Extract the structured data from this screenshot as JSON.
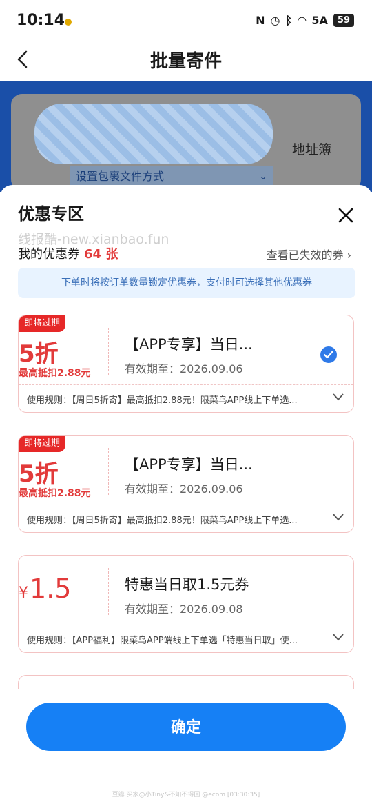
{
  "status_bar": {
    "time": "10:14",
    "icons": [
      "nfc-icon",
      "alarm-icon",
      "bluetooth-icon",
      "wifi-icon",
      "signal-5g-icon"
    ],
    "network": "5A",
    "battery": "59"
  },
  "nav": {
    "title": "批量寄件"
  },
  "background": {
    "address_book": "地址簿",
    "package_method": "设置包裹文件方式"
  },
  "sheet": {
    "title": "优惠专区",
    "watermark": "线报酷-new.xianbao.fun",
    "my_coupons_label": "我的优惠券",
    "my_coupons_count": "64 张",
    "expired_link": "查看已失效的券",
    "notice": "下单时将按订单数量锁定优惠券，支付时可选择其他优惠券"
  },
  "coupons": [
    {
      "badge": "即将过期",
      "discount": "5折",
      "max_deduct": "最高抵扣2.88元",
      "title": "【APP专享】当日...",
      "valid": "有效期至：2026.09.06",
      "rule": "使用规则：【周日5折寄】最高抵扣2.88元！限菜鸟APP线上下单选...",
      "selected": true
    },
    {
      "badge": "即将过期",
      "discount": "5折",
      "max_deduct": "最高抵扣2.88元",
      "title": "【APP专享】当日...",
      "valid": "有效期至：2026.09.06",
      "rule": "使用规则：【周日5折寄】最高抵扣2.88元！限菜鸟APP线上下单选...",
      "selected": false
    },
    {
      "currency": "¥",
      "amount": "1.5",
      "title": "特惠当日取1.5元券",
      "valid": "有效期至：2026.09.08",
      "rule": "使用规则：【APP福利】限菜鸟APP端线上下单选「特惠当日取」使...",
      "selected": false
    }
  ],
  "confirm_label": "确定",
  "footer_text": "豆瓣 买家@小Tiny&不知不得回 @ecom [03:30:35]"
}
